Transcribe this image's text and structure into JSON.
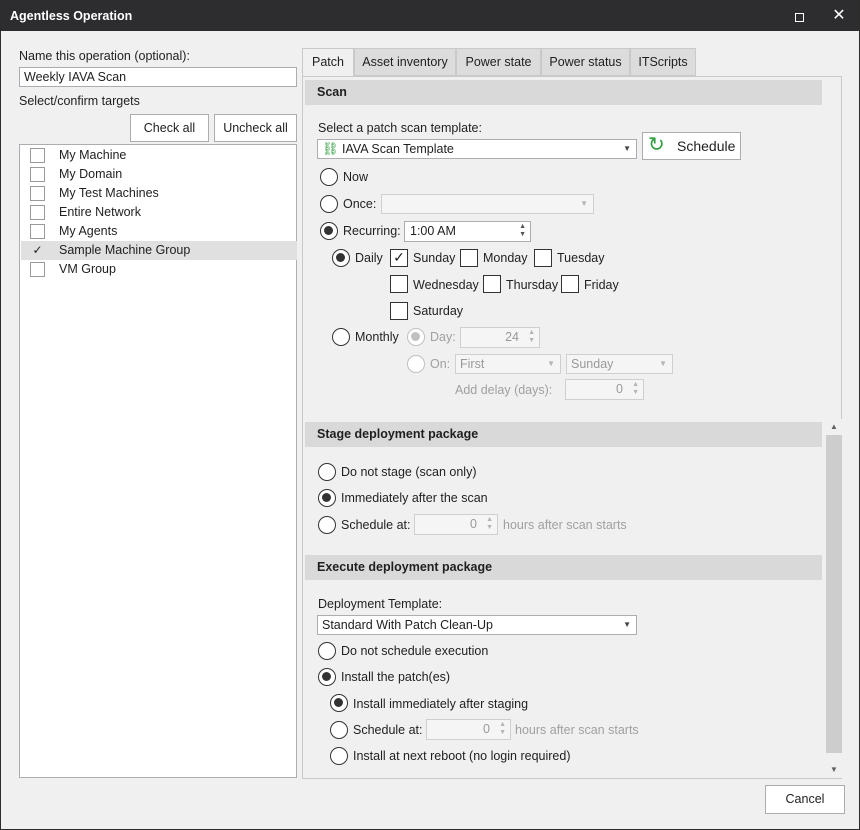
{
  "window": {
    "title": "Agentless Operation"
  },
  "left": {
    "name_label": "Name this operation (optional):",
    "name_value": "Weekly IAVA Scan",
    "targets_label": "Select/confirm targets",
    "check_all": "Check all",
    "uncheck_all": "Uncheck all",
    "targets": [
      {
        "label": "My Machine",
        "checked": false
      },
      {
        "label": "My Domain",
        "checked": false
      },
      {
        "label": "My Test Machines",
        "checked": false
      },
      {
        "label": "Entire Network",
        "checked": false
      },
      {
        "label": "My Agents",
        "checked": false
      },
      {
        "label": "Sample Machine Group",
        "checked": true,
        "check_mark": "✓"
      },
      {
        "label": "VM Group",
        "checked": false
      }
    ]
  },
  "tabs": [
    "Patch",
    "Asset inventory",
    "Power state",
    "Power status",
    "ITScripts"
  ],
  "scan": {
    "header": "Scan",
    "template_label": "Select a patch scan template:",
    "template_value": "IAVA Scan Template",
    "schedule_button": "Schedule",
    "now": "Now",
    "once": "Once:",
    "recurring": "Recurring:",
    "recurring_time": "1:00 AM",
    "daily": "Daily",
    "days": [
      "Sunday",
      "Monday",
      "Tuesday",
      "Wednesday",
      "Thursday",
      "Friday",
      "Saturday"
    ],
    "sunday_check": "✓",
    "monthly": "Monthly",
    "day_label": "Day:",
    "day_value": "24",
    "on_label": "On:",
    "on_first": "First",
    "on_day": "Sunday",
    "add_delay": "Add delay (days):",
    "delay_value": "0"
  },
  "stage": {
    "header": "Stage deployment package",
    "do_not_stage": "Do not stage (scan only)",
    "immediately": "Immediately after the scan",
    "schedule_at": "Schedule at:",
    "hours_value": "0",
    "hours_after": "hours after scan starts"
  },
  "execute": {
    "header": "Execute deployment package",
    "template_label": "Deployment Template:",
    "template_value": "Standard With Patch Clean-Up",
    "do_not_schedule": "Do not schedule execution",
    "install": "Install the patch(es)",
    "install_immediately": "Install immediately after staging",
    "schedule_at": "Schedule at:",
    "hours_value": "0",
    "hours_after": "hours after scan starts",
    "next_reboot": "Install at next reboot (no login required)"
  },
  "footer": {
    "cancel": "Cancel"
  }
}
